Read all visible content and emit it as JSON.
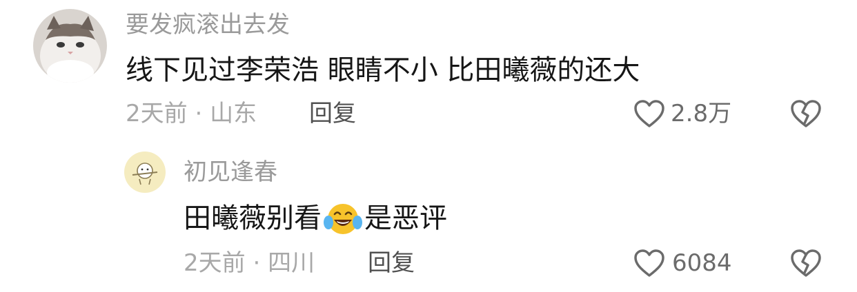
{
  "comment": {
    "username": "要发疯滚出去发",
    "text": "线下见过李荣浩 眼睛不小 比田曦薇的还大",
    "time": "2天前",
    "separator": "·",
    "location": "山东",
    "reply_label": "回复",
    "like_count": "2.8万",
    "avatar_icon": "cat-avatar-icon"
  },
  "reply": {
    "username": "初见逢春",
    "text_before": "田曦薇别看",
    "emoji_icon": "laughing-tears-emoji-icon",
    "text_after": "是恶评",
    "time": "2天前",
    "separator": "·",
    "location": "四川",
    "reply_label": "回复",
    "like_count": "6084",
    "avatar_icon": "doodle-avatar-icon"
  },
  "colors": {
    "username": "#9a9a9a",
    "content": "#161616",
    "meta": "#a8a8a8",
    "reply": "#505050",
    "icon": "#6b6b6b",
    "emoji": "#f7c32b"
  }
}
